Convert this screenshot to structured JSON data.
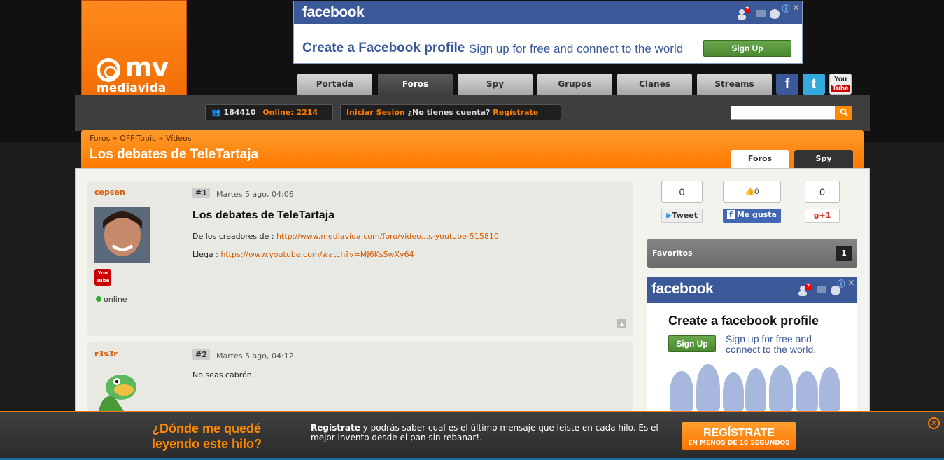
{
  "logo": {
    "mark": "mv",
    "name": "mediavida"
  },
  "top_ad": {
    "brand": "facebook",
    "headline": "Create a Facebook profile",
    "subtext": "Sign up for free and connect to the world",
    "button": "Sign Up",
    "badge": "?",
    "close": "✕",
    "info": "ⓘ"
  },
  "nav": {
    "tabs": [
      {
        "label": "Portada"
      },
      {
        "label": "Foros"
      },
      {
        "label": "Spy"
      },
      {
        "label": "Grupos"
      },
      {
        "label": "Clanes"
      },
      {
        "label": "Streams"
      }
    ],
    "active": "Foros",
    "social": {
      "facebook": "f",
      "twitter": "t",
      "youtube_top": "You",
      "youtube_bottom": "Tube"
    }
  },
  "userbar": {
    "users_count": "184410",
    "online_label": "Online: 2214",
    "login": "Iniciar Sesión",
    "no_account": "¿No tienes cuenta?",
    "register": "Regístrate",
    "search_value": "",
    "search_icon": "magnifier-icon"
  },
  "header": {
    "breadcrumb": [
      "Foros",
      "OFF-Topic",
      "Vídeos"
    ],
    "separator": "»",
    "title": "Los debates de TeleTartaja",
    "tabs": [
      {
        "label": "Foros"
      },
      {
        "label": "Spy"
      }
    ]
  },
  "posts": [
    {
      "user": "cepsen",
      "number": "#1",
      "date": "Martes 5 ago, 04:06",
      "title": "Los debates de TeleTartaja",
      "line1_prefix": "De los creadores de :",
      "line1_link": "http://www.mediavida.com/foro/video...s-youtube-515810",
      "line2_prefix": "Llega :",
      "line2_link": "https://www.youtube.com/watch?v=MJ6KsSwXy64",
      "status": "online",
      "badge_top": "You",
      "badge_bottom": "Tube"
    },
    {
      "user": "r3s3r",
      "number": "#2",
      "date": "Martes 5 ago, 04:12",
      "text": "No seas cabrón."
    }
  ],
  "share": {
    "tweet_count": "0",
    "tweet_label": "Tweet",
    "like_count": "0",
    "like_label": "Me gusta",
    "gplus_count": "0",
    "gplus_label": "+1"
  },
  "favoritos": {
    "label": "Favoritos",
    "count": "1"
  },
  "side_ad": {
    "brand": "facebook",
    "headline": "Create a facebook profile",
    "button": "Sign Up",
    "subtext": "Sign up for free and connect to the world.",
    "badge": "?",
    "close": "✕",
    "info": "ⓘ"
  },
  "footer": {
    "question_line1": "¿Dónde me quedé",
    "question_line2": "leyendo este hilo?",
    "text_bold": "Regístrate",
    "text": " y podrás saber cual es el último mensaje que leiste en cada hilo. Es el mejor invento desde el pan sin rebanar!.",
    "button_big": "REGÍSTRATE",
    "button_small": "EN MENOS DE 10 SEGUNDOS",
    "close": "✕"
  },
  "colors": {
    "accent": "#ff7a00",
    "facebook": "#3b5998",
    "link": "#d55a00"
  }
}
